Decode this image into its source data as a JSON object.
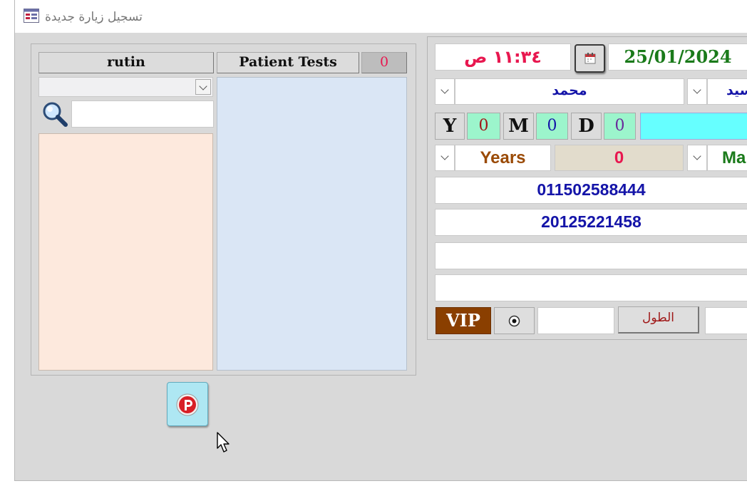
{
  "window": {
    "title": "تسجيل زيارة جديدة"
  },
  "left": {
    "rutin_label": "rutin",
    "patient_tests_label": "Patient Tests",
    "tests_count": "0",
    "rutin_combo_value": "",
    "search_value": ""
  },
  "right": {
    "time": "١١:٣٤ ص",
    "date": "25/01/2024",
    "first_name": "محمد",
    "second_name": "سيد",
    "y_label": "Y",
    "y_value": "0",
    "m_label": "M",
    "m_value": "0",
    "d_label": "D",
    "d_value": "0",
    "age_unit": "Years",
    "age_value": "0",
    "gender_partial": "Ma",
    "phone1": "011502588444",
    "phone2": "20125221458",
    "field_blank1": "",
    "field_blank2": "",
    "vip_label": "VIP",
    "height_label": "الطول",
    "height_value": ""
  },
  "colors": {
    "red_text": "#e8174f",
    "green_text": "#1a7a1a",
    "blue_text": "#1414a8",
    "brown_text": "#9a4a05",
    "vip_bg": "#8a3f00",
    "cyan_bar": "#66ffff",
    "peach_list": "#fde9dd",
    "blue_list": "#dae6f5"
  }
}
